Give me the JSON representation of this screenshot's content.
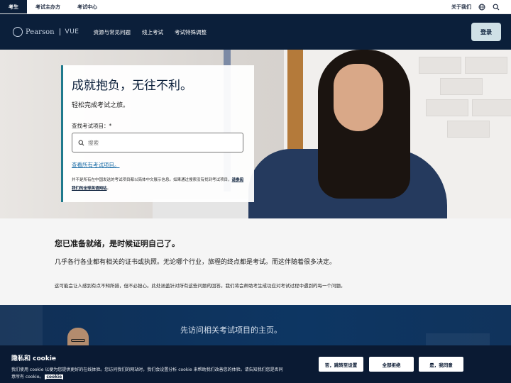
{
  "utility": {
    "tabs": [
      "考生",
      "考试主办方",
      "考试中心"
    ],
    "about": "关于我们"
  },
  "nav": {
    "logo_brand": "Pearson",
    "logo_product": "VUE",
    "links": [
      "资源与常见问题",
      "线上考试",
      "考试特殊调整"
    ],
    "login_label": "登录"
  },
  "hero": {
    "title": "成就抱负，无往不利。",
    "subtitle": "轻松完成考试之旅。",
    "search_label": "查找考试项目：*",
    "search_placeholder": "搜索",
    "all_programs_link": "查看所有考试项目。",
    "note_text": "并不是所有在中国发送的考试项目都以简体中文展示信息。如果通过搜索没有找到考试项目，",
    "note_link": "请参阅我们的全球英语网站",
    "note_end": "。"
  },
  "ready": {
    "heading": "您已准备就绪，是时候证明自己了。",
    "lead": "几乎各行各业都有相关的证书或执照。无论哪个行业，旅程的终点都是考试。而这伴随着很多决定。",
    "small": "这可能会让人感到有点不知所措，但不必担心。此处涵盖针对所有这些问题的回答。我们将会帮助考生成功应对考试过程中遇到的每一个问题。"
  },
  "dark": {
    "heading": "先访问相关考试项目的主页。"
  },
  "cookie": {
    "title": "隐私和 cookie",
    "text": "我们使用 cookie 以便为您提供更好的在线体验。您访问我们的网站时，我们会设置分析 cookie 来帮助我们改善您的体验。请告知我们您是否同意所有 cookie。",
    "link": "cookie",
    "settings_label": "否，跳转至设置",
    "reject_label": "全部拒绝",
    "accept_label": "是，我同意"
  }
}
